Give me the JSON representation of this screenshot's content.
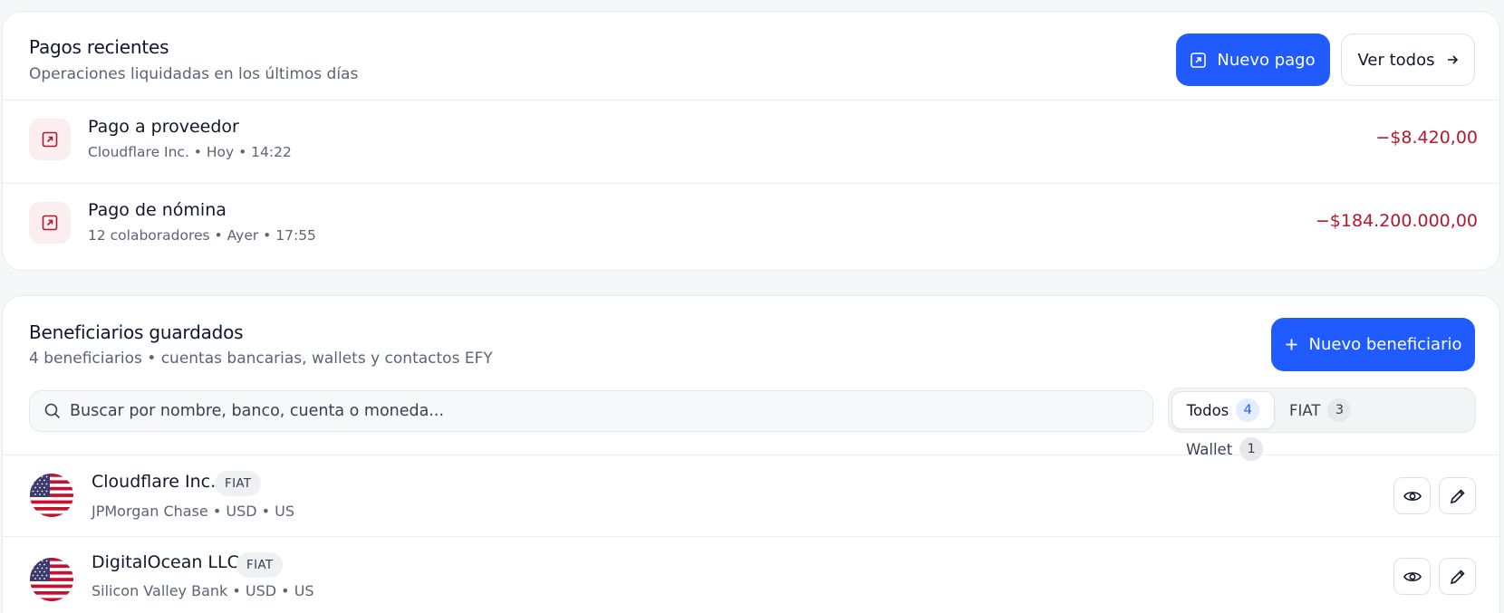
{
  "payments": {
    "title": "Pagos recientes",
    "subtitle": "Operaciones liquidadas en los últimos días",
    "new_payment_label": "Nuevo pago",
    "view_all_label": "Ver todos",
    "items": [
      {
        "title": "Pago a proveedor",
        "meta": "Cloudflare Inc. • Hoy • 14:22",
        "amount": "−$8.420,00",
        "icon": "arrow-up-right-icon"
      },
      {
        "title": "Pago de nómina",
        "meta": "12 colaboradores • Ayer • 17:55",
        "amount": "−$184.200.000,00",
        "icon": "arrow-up-right-icon"
      }
    ]
  },
  "beneficiaries": {
    "title": "Beneficiarios guardados",
    "subtitle": "4 beneficiarios • cuentas bancarias, wallets y contactos EFY",
    "new_label": "Nuevo beneficiario",
    "search_placeholder": "Buscar por nombre, banco, cuenta o moneda...",
    "filters": [
      {
        "label": "Todos",
        "count": "4",
        "active": true
      },
      {
        "label": "FIAT",
        "count": "3",
        "active": false
      },
      {
        "label": "Wallet",
        "count": "1",
        "active": false
      }
    ],
    "items": [
      {
        "name": "Cloudflare Inc.",
        "badge": "FIAT",
        "meta": "JPMorgan Chase • USD • US",
        "flag": "us-flag-icon"
      },
      {
        "name": "DigitalOcean LLC",
        "badge": "FIAT",
        "meta": "Silicon Valley Bank • USD • US",
        "flag": "us-flag-icon"
      }
    ]
  },
  "colors": {
    "primary": "#1f5bff",
    "negative_amount": "#b3182f",
    "icon_bg": "#fbeeee"
  }
}
